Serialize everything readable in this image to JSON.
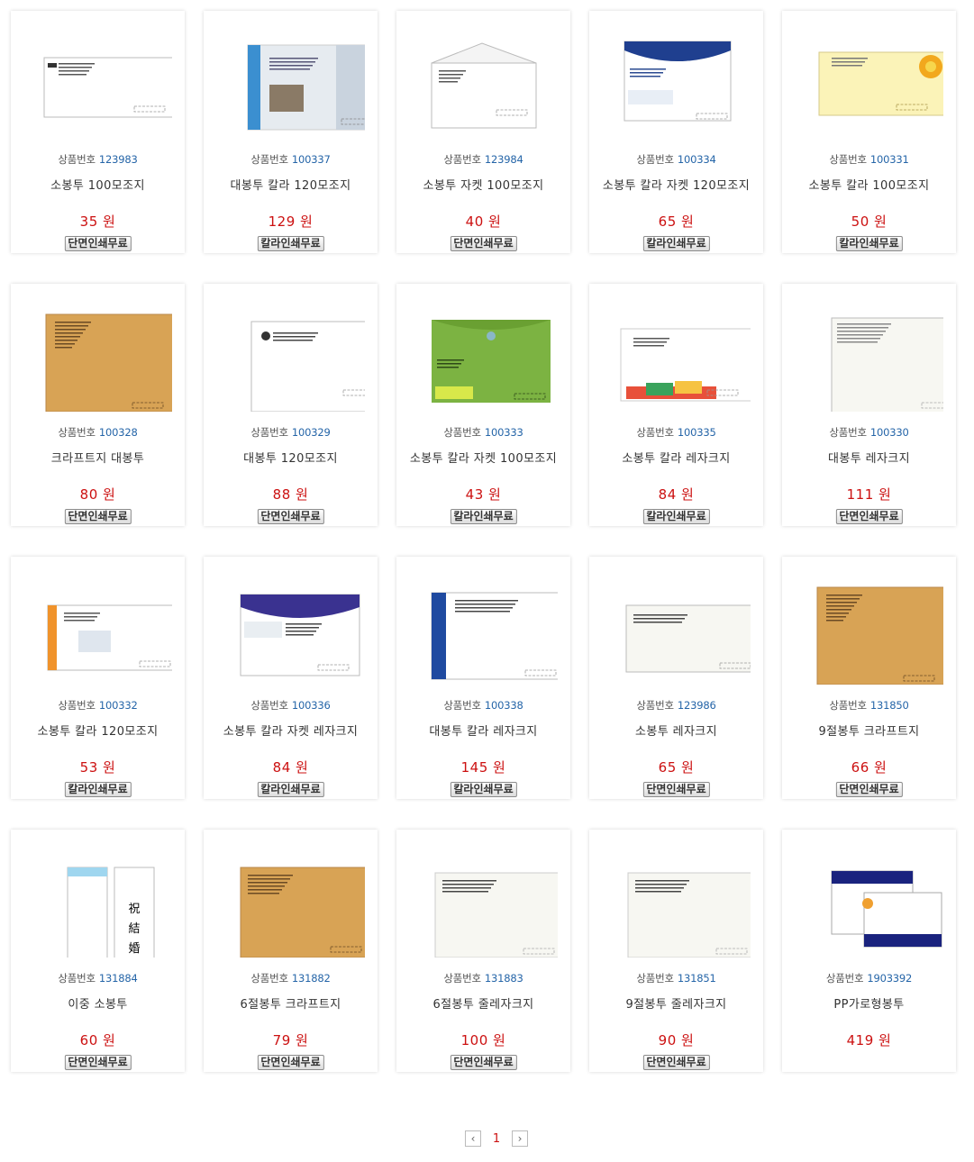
{
  "code_label": "상품번호",
  "currency": "원",
  "products": [
    {
      "code": "123983",
      "name": "소봉투 100모조지",
      "price": "35",
      "badge": "단면인쇄무료",
      "style": "plain_small",
      "color": "#ffffff"
    },
    {
      "code": "100337",
      "name": "대봉투 칼라 120모조지",
      "price": "129",
      "badge": "칼라인쇄무료",
      "style": "blue_side",
      "color": "#3b8fd0"
    },
    {
      "code": "123984",
      "name": "소봉투 자켓 100모조지",
      "price": "40",
      "badge": "단면인쇄무료",
      "style": "jacket_white",
      "color": "#ffffff"
    },
    {
      "code": "100334",
      "name": "소봉투 칼라 자켓 120모조지",
      "price": "65",
      "badge": "칼라인쇄무료",
      "style": "jacket_navy",
      "color": "#1f3f8f"
    },
    {
      "code": "100331",
      "name": "소봉투 칼라 100모조지",
      "price": "50",
      "badge": "칼라인쇄무료",
      "style": "yellow",
      "color": "#fbf3b8"
    },
    {
      "code": "100328",
      "name": "크라프트지 대봉투",
      "price": "80",
      "badge": "단면인쇄무료",
      "style": "kraft_large",
      "color": "#d8a355"
    },
    {
      "code": "100329",
      "name": "대봉투 120모조지",
      "price": "88",
      "badge": "단면인쇄무료",
      "style": "plain_large",
      "color": "#ffffff"
    },
    {
      "code": "100333",
      "name": "소봉투 칼라 자켓 100모조지",
      "price": "43",
      "badge": "칼라인쇄무료",
      "style": "green",
      "color": "#7cb342"
    },
    {
      "code": "100335",
      "name": "소봉투 칼라 레자크지",
      "price": "84",
      "badge": "칼라인쇄무료",
      "style": "colorful",
      "color": "#ffffff"
    },
    {
      "code": "100330",
      "name": "대봉투 레자크지",
      "price": "111",
      "badge": "단면인쇄무료",
      "style": "leather_large",
      "color": "#f7f7f2"
    },
    {
      "code": "100332",
      "name": "소봉투 칼라 120모조지",
      "price": "53",
      "badge": "칼라인쇄무료",
      "style": "orange_side",
      "color": "#f0932b"
    },
    {
      "code": "100336",
      "name": "소봉투 칼라 자켓 레자크지",
      "price": "84",
      "badge": "칼라인쇄무료",
      "style": "jacket_purple",
      "color": "#3a3290"
    },
    {
      "code": "100338",
      "name": "대봉투 칼라 레자크지",
      "price": "145",
      "badge": "칼라인쇄무료",
      "style": "navy_side",
      "color": "#1f4aa0"
    },
    {
      "code": "123986",
      "name": "소봉투 레자크지",
      "price": "65",
      "badge": "단면인쇄무료",
      "style": "leather_small",
      "color": "#f7f7f2"
    },
    {
      "code": "131850",
      "name": "9절봉투 크라프트지",
      "price": "66",
      "badge": "단면인쇄무료",
      "style": "kraft_large",
      "color": "#d8a355"
    },
    {
      "code": "131884",
      "name": "이중 소봉투",
      "price": "60",
      "badge": "단면인쇄무료",
      "style": "double",
      "color": "#9fd6ef"
    },
    {
      "code": "131882",
      "name": "6절봉투 크라프트지",
      "price": "79",
      "badge": "단면인쇄무료",
      "style": "kraft_wide",
      "color": "#d8a355"
    },
    {
      "code": "131883",
      "name": "6절봉투 줄레자크지",
      "price": "100",
      "badge": "단면인쇄무료",
      "style": "leather_wide",
      "color": "#f7f7f2"
    },
    {
      "code": "131851",
      "name": "9절봉투 줄레자크지",
      "price": "90",
      "badge": "단면인쇄무료",
      "style": "leather_wide",
      "color": "#f7f7f2"
    },
    {
      "code": "1903392",
      "name": "PP가로형봉투",
      "price": "419",
      "badge": "",
      "style": "pp",
      "color": "#1a237e"
    }
  ],
  "pagination": {
    "prev": "‹",
    "current": "1",
    "next": "›"
  }
}
